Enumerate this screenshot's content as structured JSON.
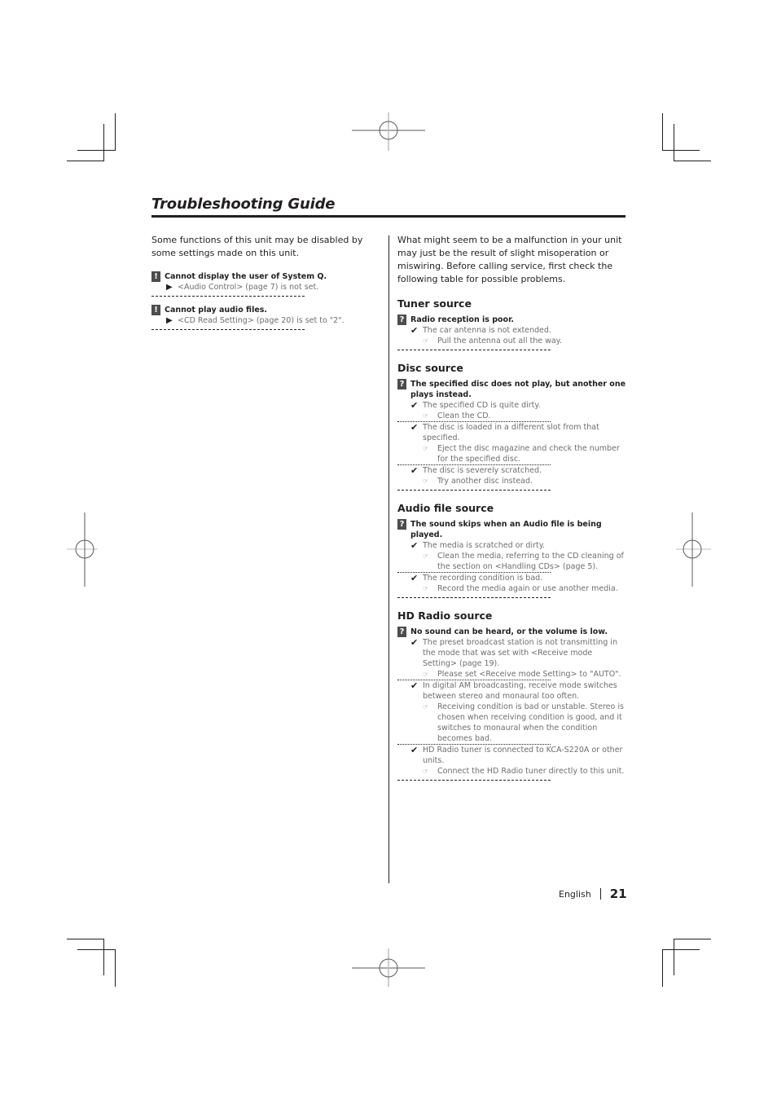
{
  "page": {
    "title": "Troubleshooting Guide",
    "language": "English",
    "page_number": "21"
  },
  "left": {
    "intro": "Some functions of this unit may be disabled by some settings made on this unit.",
    "warnings": [
      {
        "icon": "!",
        "title": "Cannot display the user of System Q.",
        "detail": "<Audio Control> (page 7) is not set."
      },
      {
        "icon": "!",
        "title": "Cannot play audio files.",
        "detail": "<CD Read Setting> (page 20) is set to \"2\"."
      }
    ]
  },
  "right": {
    "intro": "What might seem to be a malfunction in your unit may just be the result of slight misoperation or miswiring. Before calling service, first check the following table for possible problems.",
    "sections": [
      {
        "heading": "Tuner source",
        "problem": "Radio reception is poor.",
        "causes": [
          {
            "cause": "The car antenna is not extended.",
            "remedy": "Pull the antenna out all the way."
          }
        ]
      },
      {
        "heading": "Disc source",
        "problem": "The specified disc does not play, but another one plays instead.",
        "causes": [
          {
            "cause": "The specified CD is quite dirty.",
            "remedy": "Clean the CD."
          },
          {
            "cause": "The disc is loaded in a different slot from that specified.",
            "remedy": "Eject the disc magazine and check the number for the specified disc."
          },
          {
            "cause": "The disc is severely scratched.",
            "remedy": "Try another disc instead."
          }
        ]
      },
      {
        "heading": "Audio file source",
        "problem": "The sound skips when an Audio file is being played.",
        "causes": [
          {
            "cause": "The media is scratched or dirty.",
            "remedy": "Clean the media, referring to the CD cleaning of the section on <Handling CDs> (page 5)."
          },
          {
            "cause": "The recording condition is bad.",
            "remedy": "Record the media again or use another media."
          }
        ]
      },
      {
        "heading": "HD Radio source",
        "problem": "No sound can be heard, or the volume is low.",
        "causes": [
          {
            "cause": "The preset broadcast station is not transmitting in the mode that was set with <Receive mode Setting> (page 19).",
            "remedy": "Please set <Receive mode Setting> to \"AUTO\"."
          },
          {
            "cause": "In digital AM broadcasting, receive mode switches between stereo and monaural too often.",
            "remedy": "Receiving condition is bad or unstable. Stereo is chosen when receiving condition is good, and it switches to monaural when the condition becomes bad."
          },
          {
            "cause": "HD Radio tuner is connected to KCA-S220A or other units.",
            "remedy": "Connect the HD Radio tuner directly to this unit."
          }
        ]
      }
    ]
  },
  "icons": {
    "warning": "exclamation-icon",
    "question": "question-icon",
    "arrow": "play-arrow-icon",
    "check": "checkmark-icon",
    "hand": "pointing-hand-icon"
  }
}
